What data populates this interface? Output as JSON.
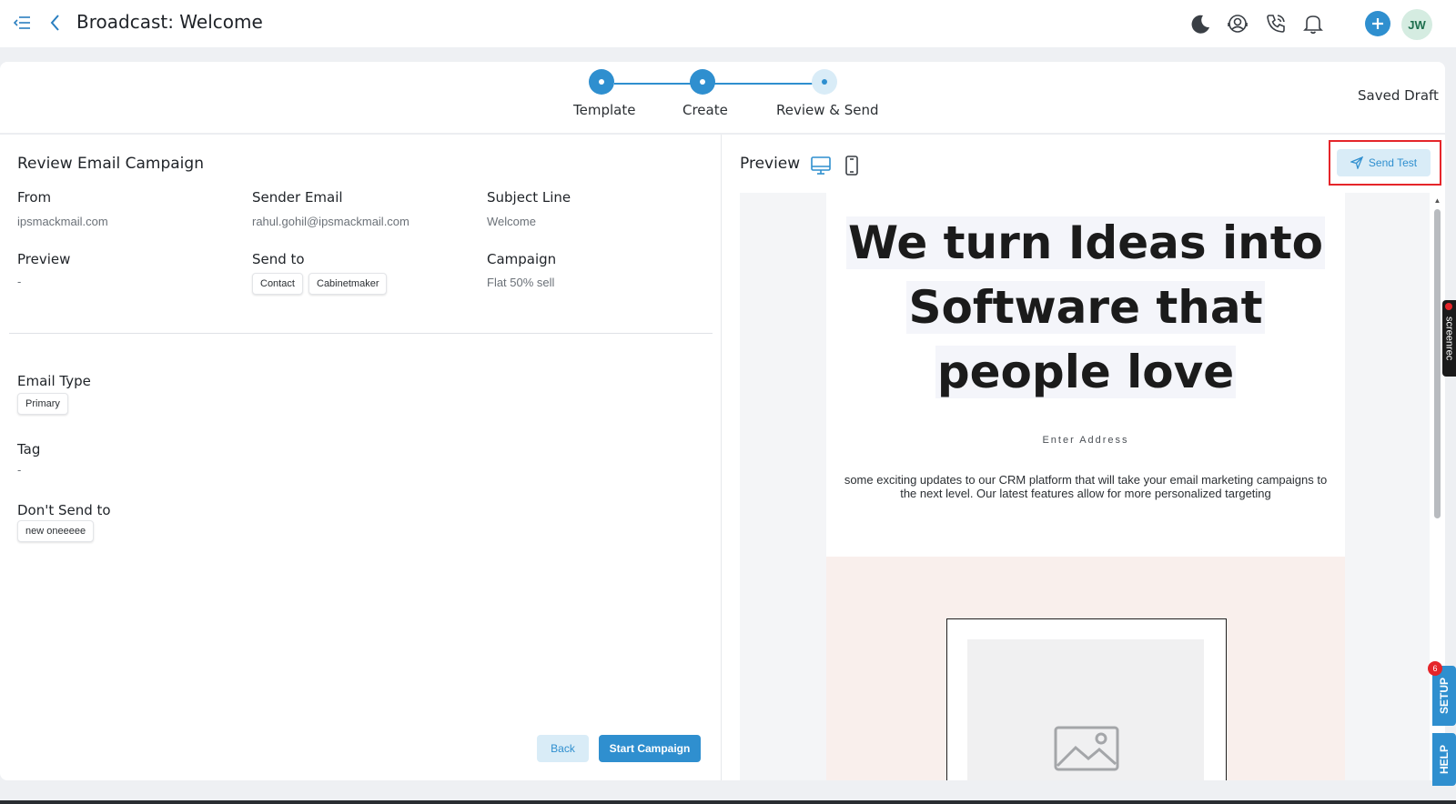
{
  "header": {
    "title": "Broadcast: Welcome",
    "avatar_initials": "JW"
  },
  "stepper": {
    "steps": [
      {
        "label": "Template",
        "state": "done"
      },
      {
        "label": "Create",
        "state": "done"
      },
      {
        "label": "Review & Send",
        "state": "current"
      }
    ],
    "status": "Saved Draft"
  },
  "review": {
    "title": "Review Email Campaign",
    "from_label": "From",
    "from_value": "ipsmackmail.com",
    "sender_email_label": "Sender Email",
    "sender_email_value": "rahul.gohil@ipsmackmail.com",
    "subject_label": "Subject Line",
    "subject_value": "Welcome",
    "preview_label": "Preview",
    "preview_value": "-",
    "send_to_label": "Send to",
    "send_to_chips": [
      "Contact",
      "Cabinetmaker"
    ],
    "campaign_label": "Campaign",
    "campaign_value": "Flat 50% sell",
    "email_type_label": "Email Type",
    "email_type_chip": "Primary",
    "tag_label": "Tag",
    "tag_value": "-",
    "dont_send_label": "Don't Send to",
    "dont_send_chip": "new oneeeee",
    "back_label": "Back",
    "start_label": "Start Campaign"
  },
  "preview": {
    "title": "Preview",
    "send_test_label": "Send Test",
    "email": {
      "hero_lines": [
        "We turn Ideas into",
        "Software that",
        "people love"
      ],
      "address": "Enter Address",
      "intro": "some exciting updates to our CRM platform that will take your email marketing campaigns to the next level. Our latest features allow for more personalized targeting"
    }
  },
  "side_widgets": {
    "screenrec_label": "screenrec",
    "setup_label": "SETUP",
    "setup_badge": "6",
    "help_label": "HELP"
  },
  "colors": {
    "accent": "#2f8fcf",
    "accent_light": "#d9ecf7",
    "highlight_red": "#e5252a",
    "section_pink": "#f9efec"
  }
}
